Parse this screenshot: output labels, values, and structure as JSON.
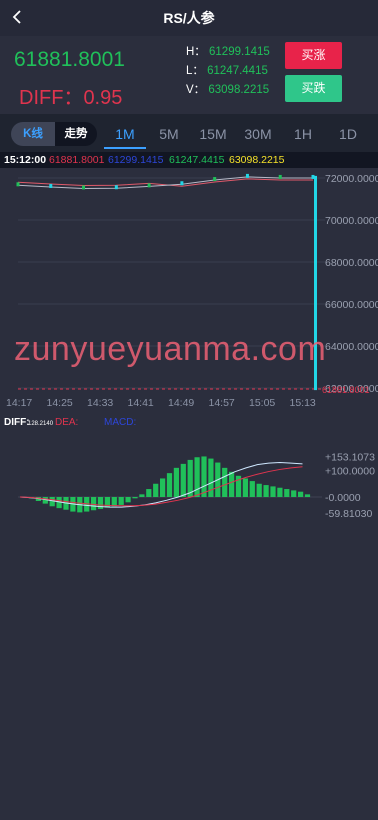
{
  "header": {
    "title": "RS/人参"
  },
  "quote": {
    "price": "61881.8001",
    "diff_label": "DIFF：",
    "diff_value": "0.95",
    "h_label": "H：",
    "h_value": "61299.1415",
    "l_label": "L：",
    "l_value": "61247.4415",
    "v_label": "V：",
    "v_value": "63098.2215",
    "rise_button": "买涨",
    "fall_button": "买跌"
  },
  "mode_tabs": {
    "kline": "K线",
    "trend": "走势"
  },
  "period_tabs": [
    "1M",
    "5M",
    "15M",
    "30M",
    "1H",
    "1D"
  ],
  "active_period": "1M",
  "legend": {
    "time": "15:12:00",
    "v1": "61881.8001",
    "v2": "61299.1415",
    "v3": "61247.4415",
    "v4": "63098.2215"
  },
  "macd_legend": {
    "diff": "DIFF:",
    "diff_value": "128.2140",
    "dea": "DEA:",
    "macd": "MACD:"
  },
  "watermark": "zunyueyuanma.com",
  "colors": {
    "up": "#20c05a",
    "down": "#e0344e",
    "accent": "#3ca0ff",
    "yellow": "#f4e12a",
    "cyan": "#22d6e6"
  },
  "chart_data": [
    {
      "type": "line",
      "x": [
        "14:17",
        "14:25",
        "14:33",
        "14:41",
        "14:49",
        "14:57",
        "15:05",
        "15:13"
      ],
      "y_ticks": [
        "72000.0000",
        "70000.0000",
        "68000.0000",
        "66000.0000",
        "64000.0000",
        "62000.0000"
      ],
      "ylim": [
        62000,
        72000
      ],
      "bottom_label": "61881.8001",
      "series": [
        {
          "values": [
            71700,
            71620,
            71550,
            71560,
            71650,
            71750,
            71950,
            72100,
            72050,
            72050,
            61900
          ]
        }
      ]
    },
    {
      "type": "bar",
      "y_ticks": [
        "+153.1073",
        "+100.0000",
        "-0.0000",
        "-59.81030"
      ],
      "series": [
        {
          "name": "MACD",
          "values": [
            0,
            -5,
            -15,
            -25,
            -35,
            -42,
            -48,
            -55,
            -58,
            -55,
            -50,
            -45,
            -40,
            -35,
            -30,
            -20,
            -5,
            10,
            30,
            50,
            70,
            90,
            110,
            125,
            140,
            150,
            153,
            145,
            130,
            110,
            95,
            80,
            70,
            60,
            50,
            45,
            40,
            35,
            30,
            25,
            20,
            10
          ]
        },
        {
          "name": "DIFF",
          "values": [
            0,
            -3,
            -8,
            -15,
            -22,
            -28,
            -32,
            -36,
            -38,
            -38,
            -35,
            -30,
            -22,
            -12,
            0,
            15,
            35,
            55,
            75,
            95,
            110,
            122,
            128,
            130,
            128,
            125
          ]
        },
        {
          "name": "DEA",
          "values": [
            0,
            -2,
            -6,
            -11,
            -17,
            -22,
            -26,
            -30,
            -32,
            -33,
            -33,
            -31,
            -27,
            -20,
            -12,
            -2,
            12,
            28,
            44,
            60,
            74,
            86,
            96,
            104,
            110,
            114
          ]
        }
      ]
    }
  ]
}
